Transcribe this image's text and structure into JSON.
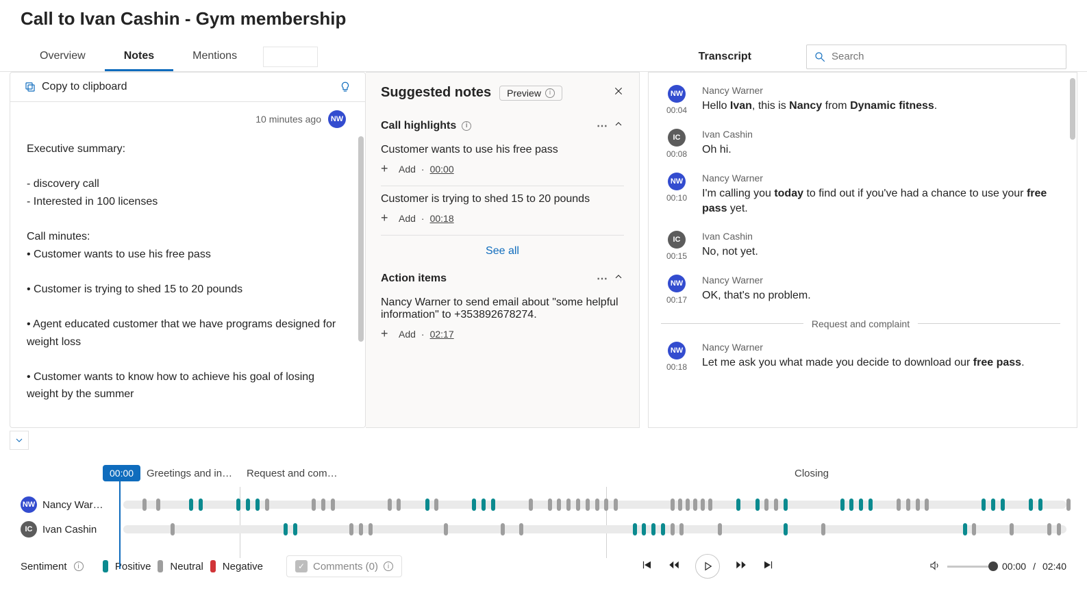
{
  "page": {
    "title": "Call to Ivan Cashin - Gym membership"
  },
  "tabs": {
    "overview": "Overview",
    "notes": "Notes",
    "mentions": "Mentions"
  },
  "transcript_header": "Transcript",
  "search": {
    "placeholder": "Search"
  },
  "notes": {
    "copy_label": "Copy to clipboard",
    "timestamp": "10 minutes ago",
    "avatar_initials": "NW",
    "body": "Executive summary:\n\n- discovery call\n- Interested in 100 licenses\n\nCall minutes:\n• Customer wants to use his free pass\n\n• Customer is trying to shed 15 to 20 pounds\n\n• Agent educated customer that we have programs designed for weight loss\n\n• Customer wants to know how to achieve his goal of losing weight by the summer"
  },
  "suggested": {
    "title": "Suggested notes",
    "preview_label": "Preview",
    "highlights_title": "Call highlights",
    "highlights": [
      {
        "text": "Customer wants to use his free pass",
        "add_label": "Add",
        "ts": "00:00"
      },
      {
        "text": "Customer is trying to shed 15 to 20 pounds",
        "add_label": "Add",
        "ts": "00:18"
      }
    ],
    "see_all": "See all",
    "actions_title": "Action items",
    "action_text": "Nancy Warner to send email about \"some helpful information\" to +353892678274.",
    "action_add": "Add",
    "action_ts": "02:17"
  },
  "transcript": [
    {
      "who": "nw",
      "name": "Nancy Warner",
      "time": "00:04",
      "html": "Hello <b>Ivan</b>, this is <b>Nancy</b> from <b>Dynamic fitness</b>."
    },
    {
      "who": "ic",
      "name": "Ivan Cashin",
      "time": "00:08",
      "html": "Oh hi."
    },
    {
      "who": "nw",
      "name": "Nancy Warner",
      "time": "00:10",
      "html": "I'm calling you <b>today</b> to find out if you've had a chance to use your <b>free pass</b> yet."
    },
    {
      "who": "ic",
      "name": "Ivan Cashin",
      "time": "00:15",
      "html": "No, not yet."
    },
    {
      "who": "nw",
      "name": "Nancy Warner",
      "time": "00:17",
      "html": "OK, that's no problem."
    }
  ],
  "transcript_divider": "Request and complaint",
  "transcript_after": {
    "who": "nw",
    "name": "Nancy Warner",
    "time": "00:18",
    "html": "Let me ask you what made you decide to download our <b>free pass</b>."
  },
  "timeline": {
    "badge": "00:00",
    "sections": {
      "greetings": "Greetings and in…",
      "request": "Request and com…",
      "closing": "Closing"
    },
    "speaker1": {
      "name": "Nancy War…",
      "initials": "NW"
    },
    "speaker2": {
      "name": "Ivan Cashin",
      "initials": "IC"
    }
  },
  "footer": {
    "sentiment_label": "Sentiment",
    "positive": "Positive",
    "neutral": "Neutral",
    "negative": "Negative",
    "comments": "Comments (0)",
    "time_cur": "00:00",
    "time_sep": "/ ",
    "time_total": "02:40"
  }
}
